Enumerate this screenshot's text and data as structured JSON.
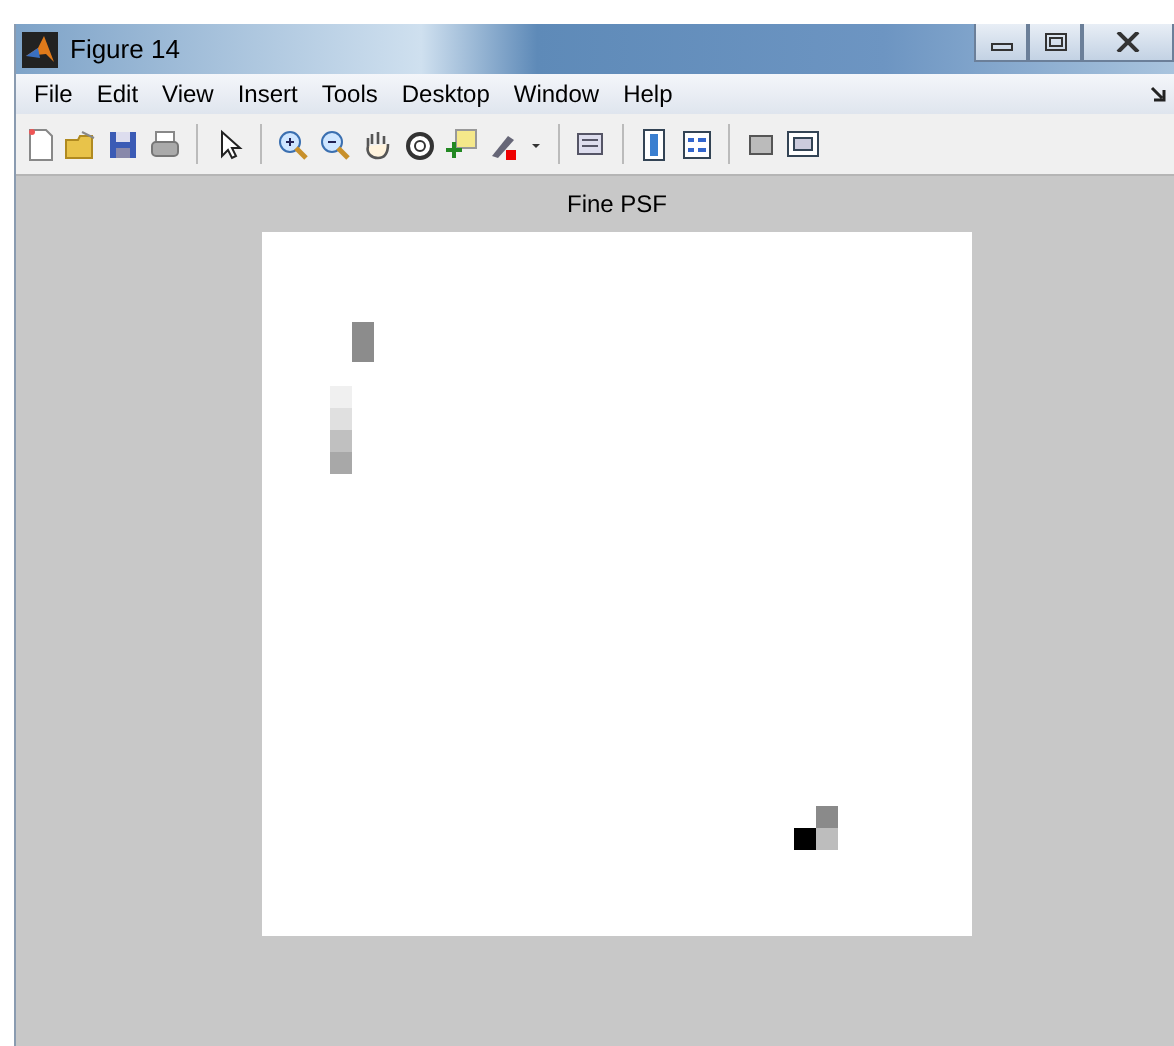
{
  "window": {
    "title": "Figure 14"
  },
  "menu": [
    "File",
    "Edit",
    "View",
    "Insert",
    "Tools",
    "Desktop",
    "Window",
    "Help"
  ],
  "toolbar": [
    {
      "kind": "new"
    },
    {
      "kind": "open"
    },
    {
      "kind": "save"
    },
    {
      "kind": "print"
    },
    {
      "kind": "sep"
    },
    {
      "kind": "pointer"
    },
    {
      "kind": "sep"
    },
    {
      "kind": "zoomin"
    },
    {
      "kind": "zoomout"
    },
    {
      "kind": "hand"
    },
    {
      "kind": "rotate"
    },
    {
      "kind": "cursor"
    },
    {
      "kind": "brush"
    },
    {
      "kind": "caret"
    },
    {
      "kind": "sep"
    },
    {
      "kind": "link"
    },
    {
      "kind": "sep"
    },
    {
      "kind": "colorbar"
    },
    {
      "kind": "legend"
    },
    {
      "kind": "sep"
    },
    {
      "kind": "hidetools"
    },
    {
      "kind": "showtools"
    }
  ],
  "axes": {
    "title": "Fine PSF",
    "kind": "picture"
  }
}
